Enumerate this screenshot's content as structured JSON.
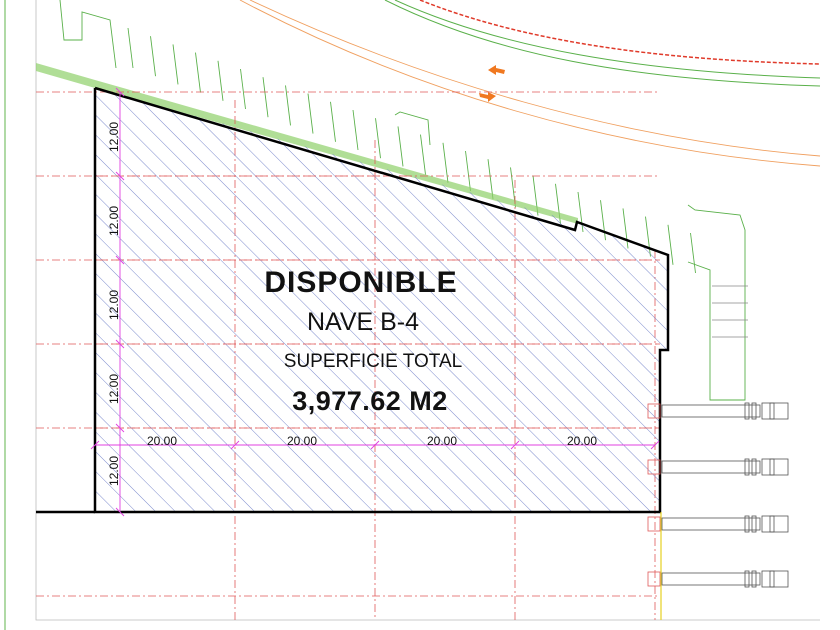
{
  "plan": {
    "status": "DISPONIBLE",
    "building": "NAVE B-4",
    "area_label": "SUPERFICIE TOTAL",
    "area_value": "3,977.62 M2",
    "horizontal_dims": [
      "20.00",
      "20.00",
      "20.00",
      "20.00"
    ],
    "vertical_dims": [
      "12.00",
      "12.00",
      "12.00",
      "12.00",
      "12.00"
    ]
  },
  "colors": {
    "hatch": "#6f7fc8",
    "outline": "#000000",
    "grid": "#e05a5a",
    "dimension": "#e040e0",
    "landscape": "#5ab04a",
    "arrow": "#f07820"
  },
  "icons": [
    "arrow-left-icon",
    "arrow-right-icon",
    "truck-icon"
  ]
}
